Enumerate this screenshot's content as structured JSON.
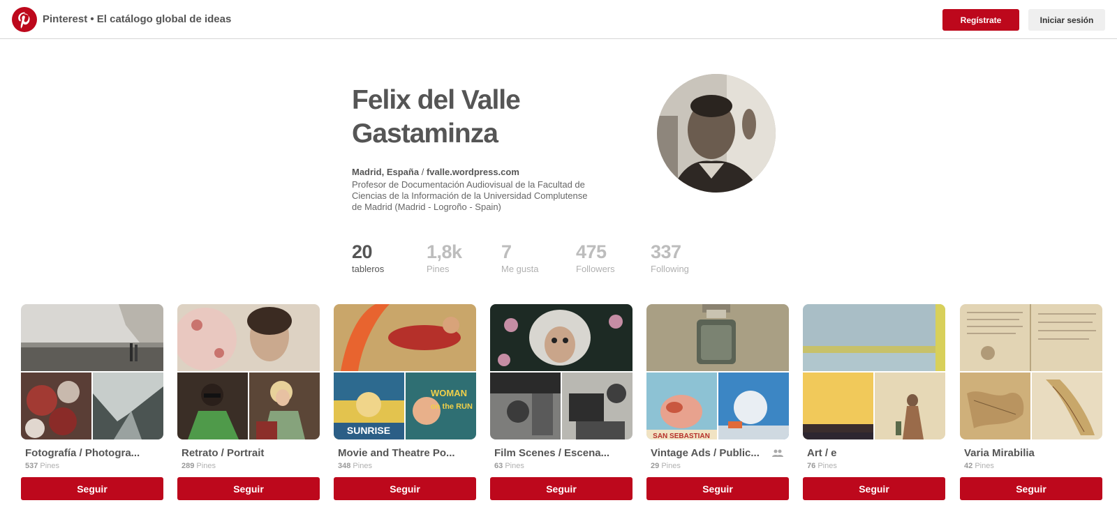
{
  "header": {
    "site_title": "Pinterest • El catálogo global de ideas",
    "signup_label": "Regístrate",
    "login_label": "Iniciar sesión"
  },
  "profile": {
    "name": "Felix del Valle Gastaminza",
    "location": "Madrid, España",
    "separator": "/",
    "website": "fvalle.wordpress.com",
    "bio": "Profesor de Documentación Audiovisual de la Facultad de Ciencias de la Información de la Universidad Complutense de Madrid (Madrid - Logroño - Spain)"
  },
  "stats": [
    {
      "value": "20",
      "label": "tableros",
      "active": true
    },
    {
      "value": "1,8k",
      "label": "Pines",
      "active": false
    },
    {
      "value": "7",
      "label": "Me gusta",
      "active": false
    },
    {
      "value": "475",
      "label": "Followers",
      "active": false
    },
    {
      "value": "337",
      "label": "Following",
      "active": false
    }
  ],
  "boards": [
    {
      "title": "Fotografía / Photogra...",
      "count": "537",
      "unit": "Pines",
      "follow_label": "Seguir",
      "collab": false
    },
    {
      "title": "Retrato / Portrait",
      "count": "289",
      "unit": "Pines",
      "follow_label": "Seguir",
      "collab": false
    },
    {
      "title": "Movie and Theatre Po...",
      "count": "348",
      "unit": "Pines",
      "follow_label": "Seguir",
      "collab": false
    },
    {
      "title": "Film Scenes / Escena...",
      "count": "63",
      "unit": "Pines",
      "follow_label": "Seguir",
      "collab": false
    },
    {
      "title": "Vintage Ads / Public...",
      "count": "29",
      "unit": "Pines",
      "follow_label": "Seguir",
      "collab": true
    },
    {
      "title": "Art / e",
      "count": "76",
      "unit": "Pines",
      "follow_label": "Seguir",
      "collab": false
    },
    {
      "title": "Varia Mirabilia",
      "count": "42",
      "unit": "Pines",
      "follow_label": "Seguir",
      "collab": false
    }
  ],
  "poster_text": {
    "sunrise": "SUNRISE",
    "woman": "WOMAN",
    "on_the_run": "on the RUN",
    "san_sebastian": "SAN SEBASTIAN"
  },
  "colors": {
    "brand_red": "#bd081c",
    "text_dark": "#555555",
    "text_muted": "#b0b0b0"
  }
}
